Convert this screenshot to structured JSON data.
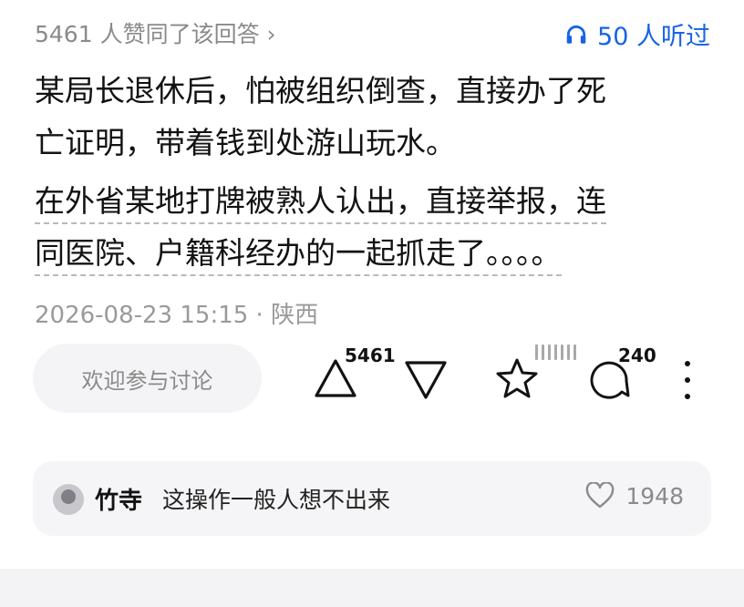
{
  "header": {
    "likes_summary": "5461 人赞同了该回答 ›",
    "listen_label": "50 人听过",
    "listen_icon": "headphones-icon"
  },
  "answer": {
    "paragraph1": [
      "某局长退休后，怕被组织倒查，直接办了死",
      "亡证明，带着钱到处游山玩水。"
    ],
    "paragraph2": [
      "在外省某地打牌被熟人认出，直接举报，连",
      "同医院、户籍科经办的一起抓走了。。。。"
    ]
  },
  "meta": {
    "text": "2026-08-23 15:15 · 陕西"
  },
  "actions": {
    "comment_placeholder": "欢迎参与讨论",
    "upvote_count": "5461",
    "comment_count": "240"
  },
  "hot_comment": {
    "author": "竹寺",
    "text": "这操作一般人想不出来",
    "likes": "1948"
  },
  "colors": {
    "accent": "#1763e8",
    "muted": "#8a8a8a",
    "card_bg": "#f5f5f7"
  }
}
